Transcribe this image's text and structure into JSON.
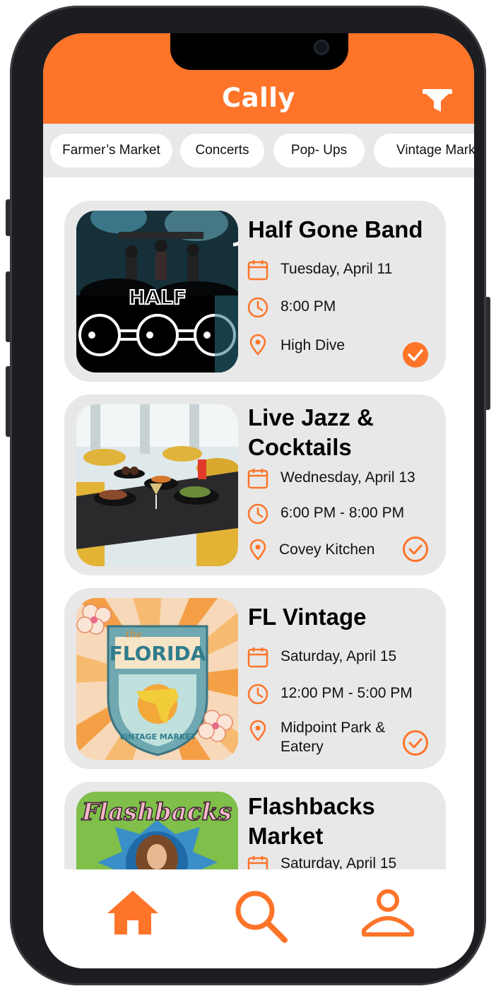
{
  "app": {
    "title": "Cally",
    "accent_color": "#fe7429"
  },
  "header": {
    "filter_icon": "filter-icon"
  },
  "chips": [
    {
      "label": "Farmer’s Market"
    },
    {
      "label": "Concerts"
    },
    {
      "label": "Pop- Ups"
    },
    {
      "label": "Vintage Markets"
    }
  ],
  "events": [
    {
      "title": "Half Gone Band",
      "date": "Tuesday, April 11",
      "time": "8:00 PM",
      "location": "High Dive",
      "saved": true,
      "image": "band-concert-image",
      "image_text": "HALF"
    },
    {
      "title_line1": "Live Jazz &",
      "title_line2": "Cocktails",
      "date": "Wednesday, April 13",
      "time": "6:00 PM - 8:00 PM",
      "location": "Covey Kitchen",
      "saved": false,
      "image": "restaurant-table-image"
    },
    {
      "title": "FL Vintage",
      "date": "Saturday, April 15",
      "time": "12:00 PM - 5:00 PM",
      "location_line1": "Midpoint Park &",
      "location_line2": "Eatery",
      "saved": false,
      "image": "florida-vintage-market-logo",
      "image_text_top": "FLORIDA",
      "image_text_small": "the",
      "image_text_bottom": "VINTAGE MARKET"
    },
    {
      "title_line1": "Flashbacks",
      "title_line2": "Market",
      "date": "Saturday, April 15",
      "image": "flashbacks-market-poster",
      "image_text": "Flashbacks"
    }
  ],
  "tabbar": {
    "items": [
      {
        "name": "home",
        "icon": "home-icon",
        "active": true
      },
      {
        "name": "search",
        "icon": "search-icon"
      },
      {
        "name": "profile",
        "icon": "user-icon"
      }
    ]
  }
}
